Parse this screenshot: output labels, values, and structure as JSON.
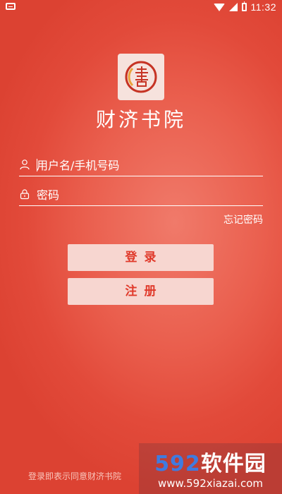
{
  "status_bar": {
    "time": "11:32"
  },
  "app": {
    "title": "财济书院",
    "logo_text": "書"
  },
  "form": {
    "username_placeholder": "用户名/手机号码",
    "password_placeholder": "密码",
    "forgot_label": "忘记密码",
    "login_label": "登录",
    "register_label": "注册"
  },
  "agreement_text": "登录即表示同意财济书院",
  "watermark": {
    "brand_number": "592",
    "brand_text": "软件园",
    "url": "www.592xiazai.com"
  },
  "colors": {
    "accent": "#e24a3a",
    "button_bg": "#f7d6d0",
    "button_text": "#e0392a"
  }
}
